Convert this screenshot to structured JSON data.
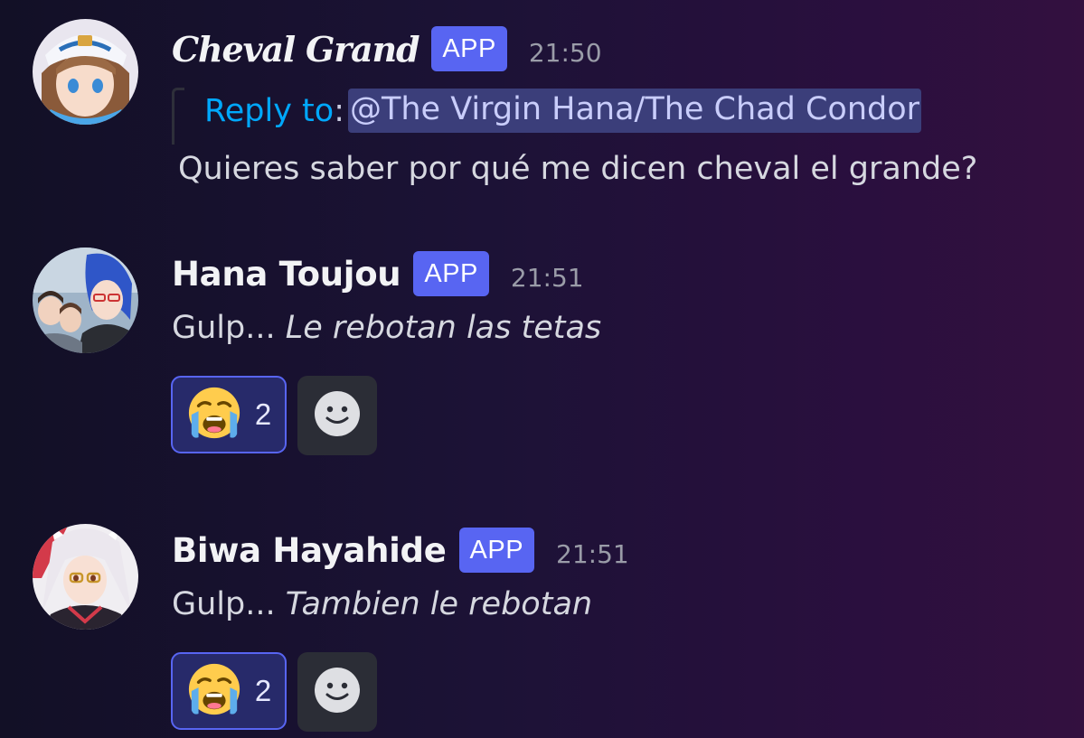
{
  "messages": [
    {
      "username": "Cheval Grand",
      "badge": "APP",
      "timestamp": "21:50",
      "reply": {
        "label": "Reply to",
        "colon": ":",
        "mention": "@The Virgin Hana/The Chad Condor"
      },
      "content_plain": "Quieres saber por qué me dicen cheval el grande?",
      "avatar_icon": "anime-girl-white-cap-avatar"
    },
    {
      "username": "Hana Toujou",
      "badge": "APP",
      "timestamp": "21:51",
      "content_plain": "Gulp... ",
      "content_italic": "Le rebotan las tetas",
      "avatar_icon": "anime-blue-hair-group-avatar",
      "reactions": [
        {
          "emoji": "😭",
          "emoji_name": "loudly-crying-face",
          "count": "2"
        }
      ],
      "add_reaction_icon": "add-reaction-smiley-icon"
    },
    {
      "username": "Biwa Hayahide",
      "badge": "APP",
      "timestamp": "21:51",
      "content_plain": "Gulp... ",
      "content_italic": "Tambien le rebotan",
      "avatar_icon": "anime-white-hair-glasses-avatar",
      "reactions": [
        {
          "emoji": "😭",
          "emoji_name": "loudly-crying-face",
          "count": "2"
        }
      ],
      "add_reaction_icon": "add-reaction-smiley-icon"
    }
  ],
  "colors": {
    "badge": "#5865f2",
    "reply_label": "#00a8fc",
    "mention_bg": "#3b3e7a",
    "reaction_bg": "#272a6a",
    "reaction_border": "#5865f2"
  }
}
